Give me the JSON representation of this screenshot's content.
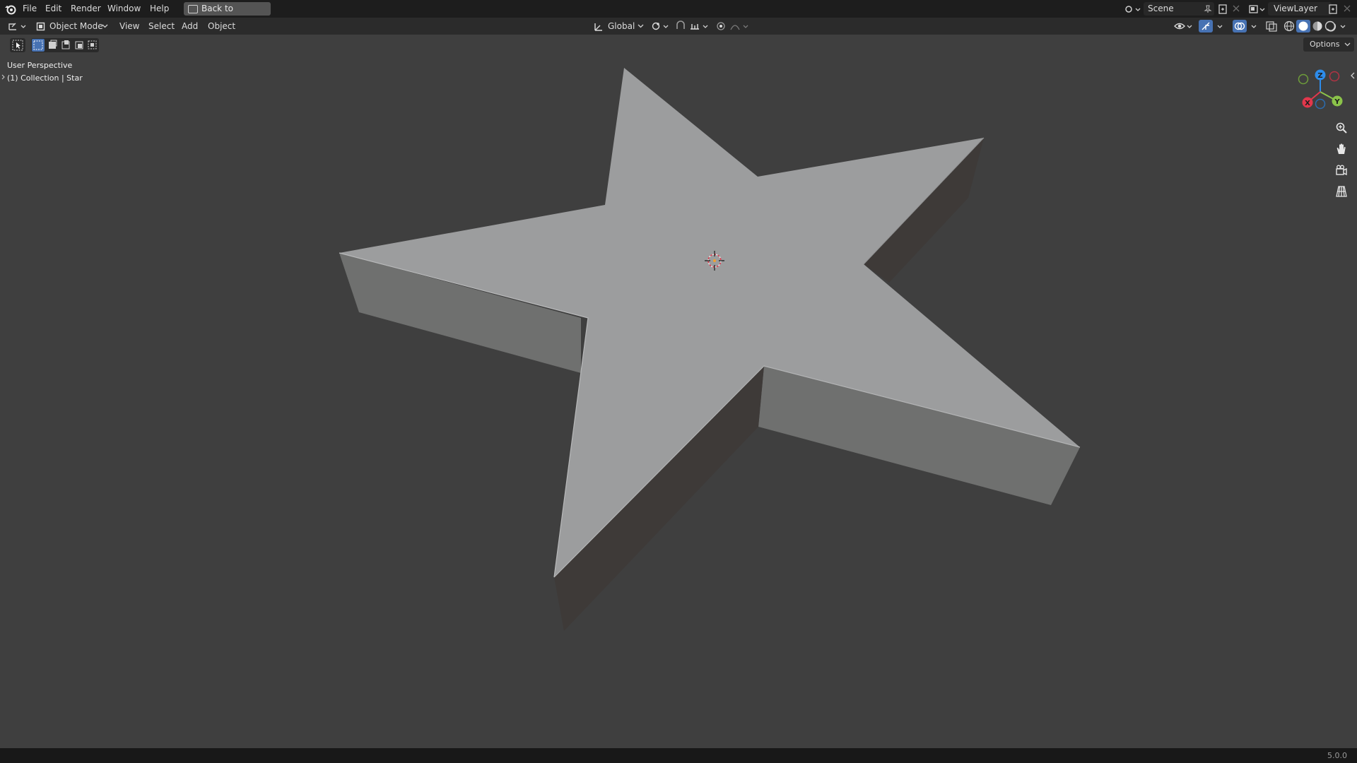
{
  "topbar": {
    "menus": [
      "File",
      "Edit",
      "Render",
      "Window",
      "Help"
    ],
    "back_button": "Back to Previous",
    "scene_name": "Scene",
    "view_layer": "ViewLayer"
  },
  "header": {
    "mode": "Object Mode",
    "menus": [
      "View",
      "Select",
      "Add",
      "Object"
    ],
    "transform_orientation": "Global"
  },
  "viewport": {
    "perspective_label": "User Perspective",
    "collection_label": "(1) Collection | Star",
    "options_label": "Options",
    "gizmo_axes": {
      "z": "Z",
      "y": "Y",
      "x": "X"
    }
  },
  "statusbar": {
    "version": "5.0.0"
  },
  "colors": {
    "background": "#3f3f3f",
    "topbar": "#1d1d1d",
    "header": "#2b2b2b",
    "star_top": "#9c9d9e",
    "star_side_light": "#6f706f",
    "star_side_dark": "#3e3a38",
    "axis_x": "#e2374c",
    "axis_y": "#8bc34a",
    "axis_z": "#2d8ceb",
    "accent_blue": "#4772b3"
  },
  "icons": [
    "blender-logo-icon",
    "editor-type-icon",
    "object-mode-icon",
    "select-box-icon",
    "global-orientation-icon",
    "pivot-icon",
    "snap-icon",
    "proportional-edit-icon",
    "visibility-icon",
    "gizmo-icon",
    "overlay-icon",
    "xray-icon",
    "shading-wireframe-icon",
    "shading-solid-icon",
    "shading-material-icon",
    "shading-rendered-icon",
    "zoom-icon",
    "pan-hand-icon",
    "camera-icon",
    "grid-icon"
  ]
}
